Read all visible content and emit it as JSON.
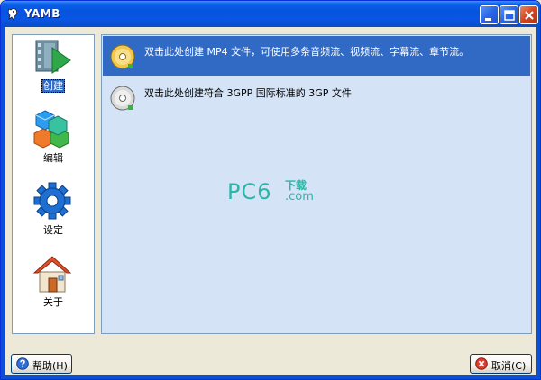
{
  "window": {
    "title": "YAMB",
    "title_icon": "gnu-icon"
  },
  "sidebar": {
    "items": [
      {
        "label": "创建",
        "icon": "create-film-icon",
        "selected": true
      },
      {
        "label": "编辑",
        "icon": "edit-cubes-icon",
        "selected": false
      },
      {
        "label": "设定",
        "icon": "settings-gear-icon",
        "selected": false
      },
      {
        "label": "关于",
        "icon": "about-house-icon",
        "selected": false
      }
    ]
  },
  "content": {
    "items": [
      {
        "text": "双击此处创建 MP4 文件，可使用多条音频流、视频流、字幕流、章节流。",
        "icon": "gold-disc-icon",
        "selected": true
      },
      {
        "text": "双击此处创建符合 3GPP 国际标准的 3GP 文件",
        "icon": "silver-disc-icon",
        "selected": false
      }
    ]
  },
  "watermark": {
    "main": "PC6",
    "small": "下载",
    "suffix": ".com"
  },
  "buttons": {
    "help": "帮助(H)",
    "cancel": "取消(C)"
  },
  "colors": {
    "titlebar": "#0654e0",
    "selection": "#316ac5",
    "content_bg": "#d4e3f5",
    "watermark": "#2bb5a7"
  }
}
